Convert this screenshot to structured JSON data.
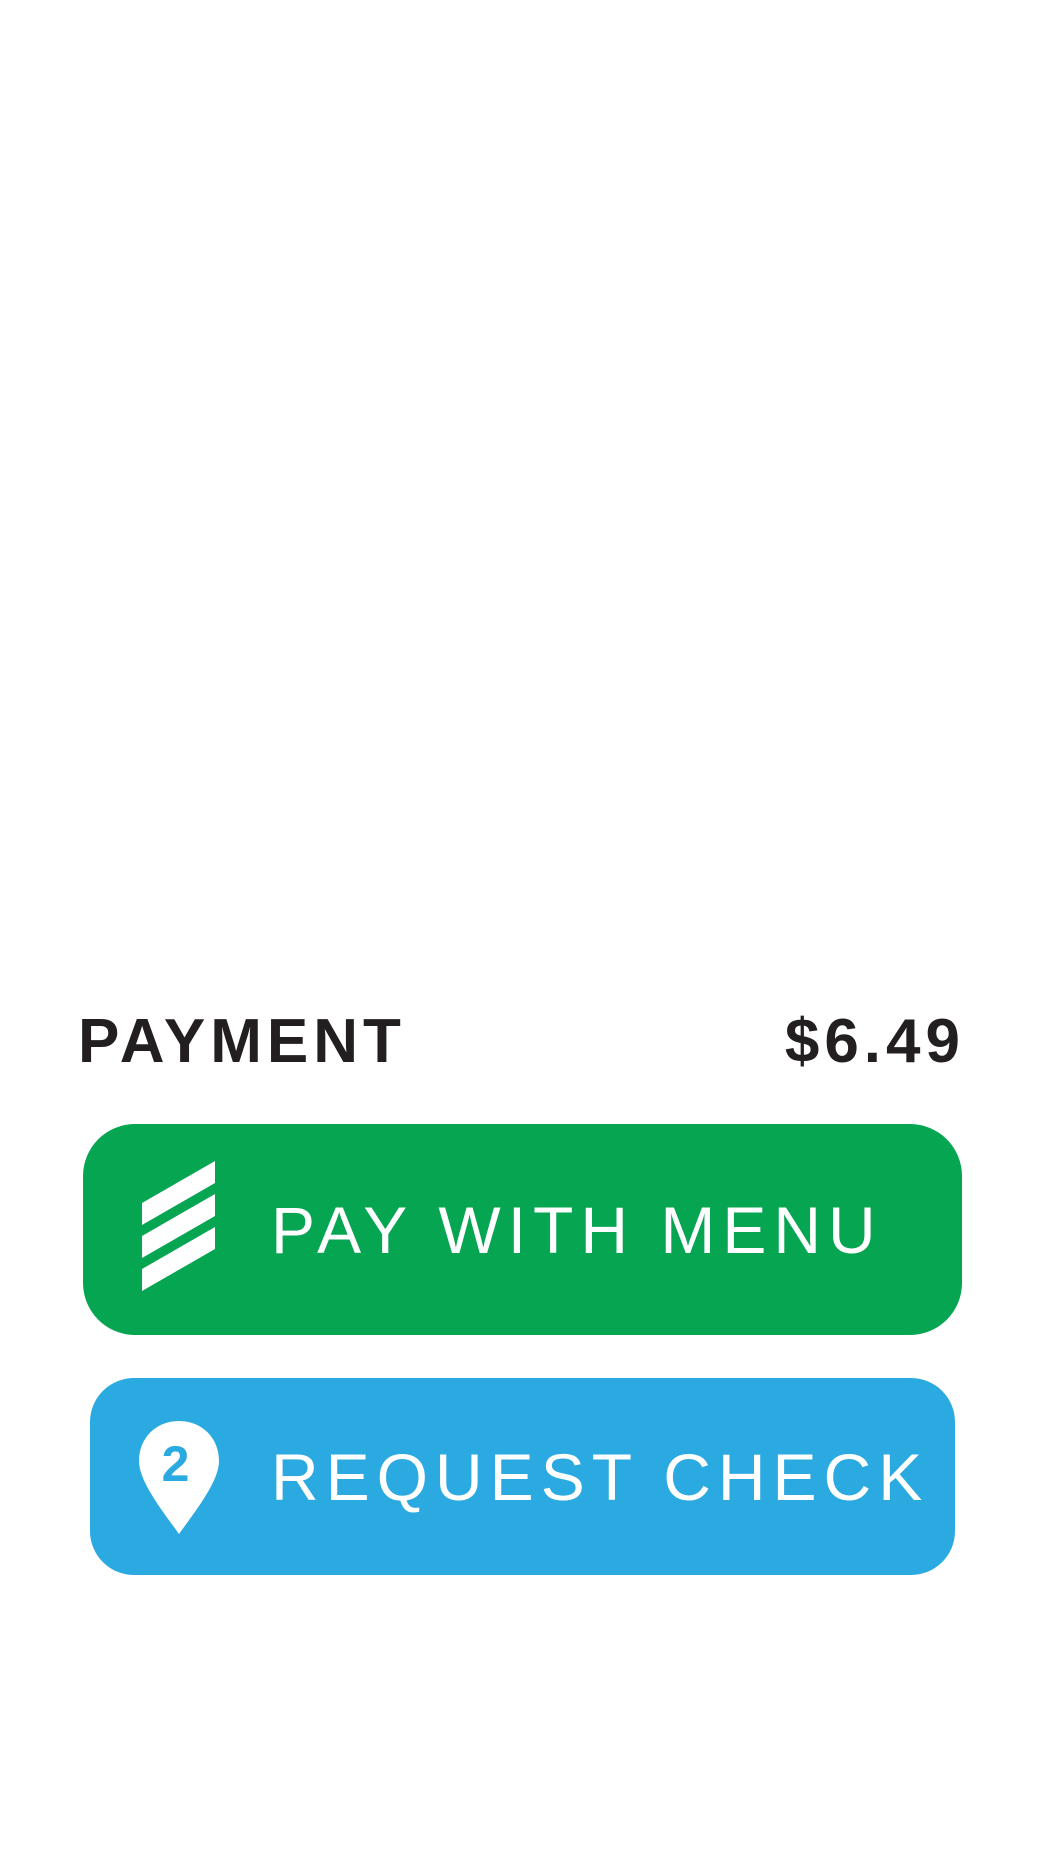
{
  "payment": {
    "label": "PAYMENT",
    "amount": "$6.49"
  },
  "buttons": {
    "pay_with_menu": {
      "label": "PAY WITH MENU",
      "icon": "menu-stripes-icon",
      "color": "#05a551"
    },
    "request_check": {
      "label": "REQUEST CHECK",
      "icon": "location-pin-2-icon",
      "badge": "2",
      "color": "#2baae1"
    }
  },
  "colors": {
    "background": "#ffffff",
    "text": "#231f20",
    "button_text": "#ffffff"
  }
}
